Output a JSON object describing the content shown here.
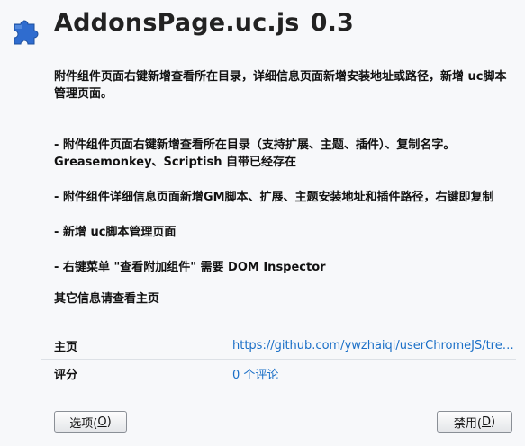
{
  "header": {
    "icon": "puzzle-piece-icon",
    "icon_color": "#2f6ccf",
    "name": "AddonsPage.uc.js",
    "version": "0.3"
  },
  "description": {
    "lines": [
      "附件组件页面右键新增查看所在目录，详细信息页面新增安装地址或路径，新增 uc脚本管理页面。",
      "- 附件组件页面右键新增查看所在目录（支持扩展、主题、插件）、复制名字。\nGreasemonkey、Scriptish 自带已经存在",
      "- 附件组件详细信息页面新增GM脚本、扩展、主题安装地址和插件路径，右键即复制",
      "- 新增 uc脚本管理页面",
      "- 右键菜单 \"查看附加组件\" 需要 DOM Inspector",
      "其它信息请查看主页"
    ]
  },
  "details": {
    "homepage_label": "主页",
    "homepage_value": "https://github.com/ywzhaiqi/userChromeJS/tree...",
    "rating_label": "评分",
    "rating_value": "0 个评论",
    "link_color": "#1a6fc7"
  },
  "buttons": {
    "options_label": "选项(",
    "options_key": "O",
    "options_tail": ")",
    "disable_label": "禁用(",
    "disable_key": "D",
    "disable_tail": ")"
  }
}
